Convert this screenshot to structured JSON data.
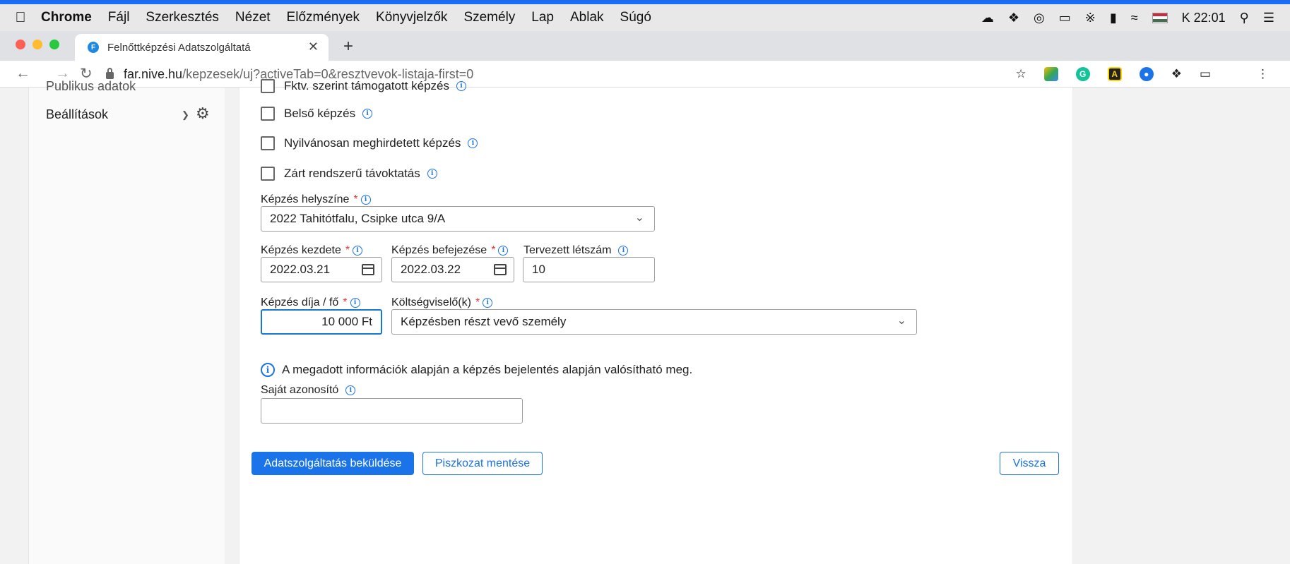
{
  "menubar": {
    "app": "Chrome",
    "items": [
      "Fájl",
      "Szerkesztés",
      "Nézet",
      "Előzmények",
      "Könyvjelzők",
      "Személy",
      "Lap",
      "Ablak",
      "Súgó"
    ],
    "clock": "K 22:01"
  },
  "tab": {
    "title": "Felnőttképzési Adatszolgáltatá",
    "favicon": "F"
  },
  "url": {
    "host": "far.nive.hu",
    "path": "/kepzesek/uj?activeTab=0&resztvevok-listaja-first=0"
  },
  "sidebar": {
    "partial_item": "Publikus adatok",
    "settings_label": "Beállítások"
  },
  "form": {
    "checkboxes": [
      "Fktv. szerint támogatott képzés",
      "Belső képzés",
      "Nyilvánosan meghirdetett képzés",
      "Zárt rendszerű távoktatás"
    ],
    "location": {
      "label": "Képzés helyszíne",
      "value": "2022 Tahitótfalu, Csipke utca 9/A"
    },
    "start": {
      "label": "Képzés kezdete",
      "value": "2022.03.21"
    },
    "end": {
      "label": "Képzés befejezése",
      "value": "2022.03.22"
    },
    "headcount": {
      "label": "Tervezett létszám",
      "value": "10"
    },
    "fee": {
      "label": "Képzés díja / fő",
      "value": "10 000 Ft"
    },
    "payer": {
      "label": "Költségviselő(k)",
      "value": "Képzésben részt vevő személy"
    },
    "notice": "A megadott információk alapján a képzés bejelentés alapján valósítható meg.",
    "own_id": {
      "label": "Saját azonosító",
      "value": ""
    },
    "required_mark": "*"
  },
  "buttons": {
    "submit": "Adatszolgáltatás beküldése",
    "draft": "Piszkozat mentése",
    "back": "Vissza"
  },
  "colors": {
    "accent": "#1a73e8",
    "required": "#e53935"
  }
}
